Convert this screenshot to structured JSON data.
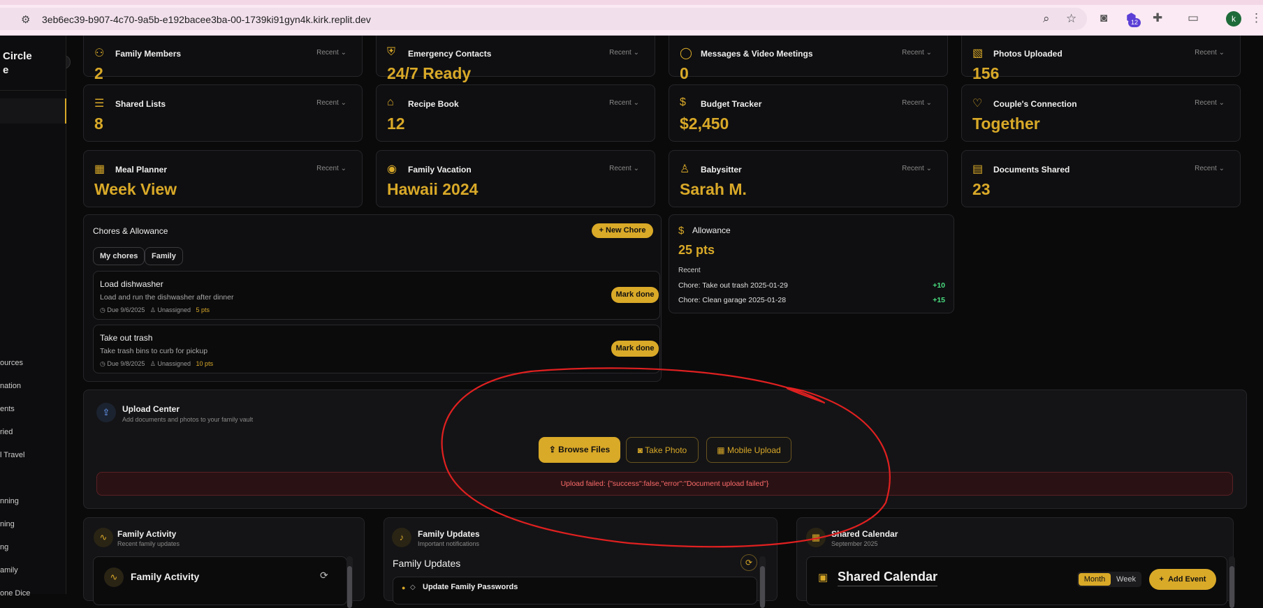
{
  "browser": {
    "url": "3eb6ec39-b907-4c70-9a5b-e192bacee3ba-00-1739ki91gyn4k.kirk.replit.dev",
    "extension_badge": "12",
    "avatar_letter": "k"
  },
  "sidebar": {
    "brand_line1": "Circle",
    "brand_line2": "e",
    "items": [
      "ources",
      "nation",
      "ents",
      "ried",
      "l Travel",
      "nning",
      "ning",
      "ng",
      "amily",
      "one Dice"
    ]
  },
  "stats": [
    {
      "title": "Family Members",
      "value": "2",
      "recent": "Recent",
      "icon": "users-icon"
    },
    {
      "title": "Emergency Contacts",
      "value": "24/7 Ready",
      "recent": "Recent",
      "icon": "shield-icon"
    },
    {
      "title": "Messages & Video Meetings",
      "value": "0",
      "recent": "Recent",
      "icon": "chat-icon"
    },
    {
      "title": "Photos Uploaded",
      "value": "156",
      "recent": "Recent",
      "icon": "image-icon"
    },
    {
      "title": "Shared Lists",
      "value": "8",
      "recent": "Recent",
      "icon": "list-icon"
    },
    {
      "title": "Recipe Book",
      "value": "12",
      "recent": "Recent",
      "icon": "chef-hat-icon"
    },
    {
      "title": "Budget Tracker",
      "value": "$2,450",
      "recent": "Recent",
      "icon": "dollar-icon"
    },
    {
      "title": "Couple's Connection",
      "value": "Together",
      "recent": "Recent",
      "icon": "heart-icon"
    },
    {
      "title": "Meal Planner",
      "value": "Week View",
      "recent": "Recent",
      "icon": "calendar-icon"
    },
    {
      "title": "Family Vacation",
      "value": "Hawaii 2024",
      "recent": "Recent",
      "icon": "map-pin-icon"
    },
    {
      "title": "Babysitter",
      "value": "Sarah M.",
      "recent": "Recent",
      "icon": "user-icon"
    },
    {
      "title": "Documents Shared",
      "value": "23",
      "recent": "Recent",
      "icon": "document-icon"
    }
  ],
  "chores": {
    "title": "Chores & Allowance",
    "new_button": "New Chore",
    "tabs": [
      "My chores",
      "Family"
    ],
    "items": [
      {
        "title": "Load dishwasher",
        "desc": "Load and run the dishwasher after dinner",
        "due": "Due 9/6/2025",
        "assignee": "Unassigned",
        "points": "5 pts",
        "action": "Mark done"
      },
      {
        "title": "Take out trash",
        "desc": "Take trash bins to curb for pickup",
        "due": "Due 9/8/2025",
        "assignee": "Unassigned",
        "points": "10 pts",
        "action": "Mark done"
      }
    ]
  },
  "allowance": {
    "title": "Allowance",
    "points": "25 pts",
    "recent_label": "Recent",
    "entries": [
      {
        "label": "Chore: Take out trash 2025-01-29",
        "delta": "+10"
      },
      {
        "label": "Chore: Clean garage 2025-01-28",
        "delta": "+15"
      }
    ]
  },
  "upload": {
    "title": "Upload Center",
    "subtitle": "Add documents and photos to your family vault",
    "browse": "Browse Files",
    "photo": "Take Photo",
    "mobile": "Mobile Upload",
    "error": "Upload failed: {\"success\":false,\"error\":\"Document upload failed\"}"
  },
  "activity": {
    "title": "Family Activity",
    "subtitle": "Recent family updates",
    "inner_title": "Family Activity"
  },
  "updates": {
    "title": "Family Updates",
    "subtitle": "Important notifications",
    "inner_title": "Family Updates",
    "first_item": "Update Family Passwords"
  },
  "calendar": {
    "title": "Shared Calendar",
    "subtitle": "September 2025",
    "inner_title": "Shared Calendar",
    "month": "Month",
    "week": "Week",
    "add": "Add Event"
  },
  "colors": {
    "accent": "#d9a928",
    "background": "#0a0a0b",
    "error": "#ff6b6b",
    "positive": "#4ade80",
    "annotation": "#e02020"
  }
}
